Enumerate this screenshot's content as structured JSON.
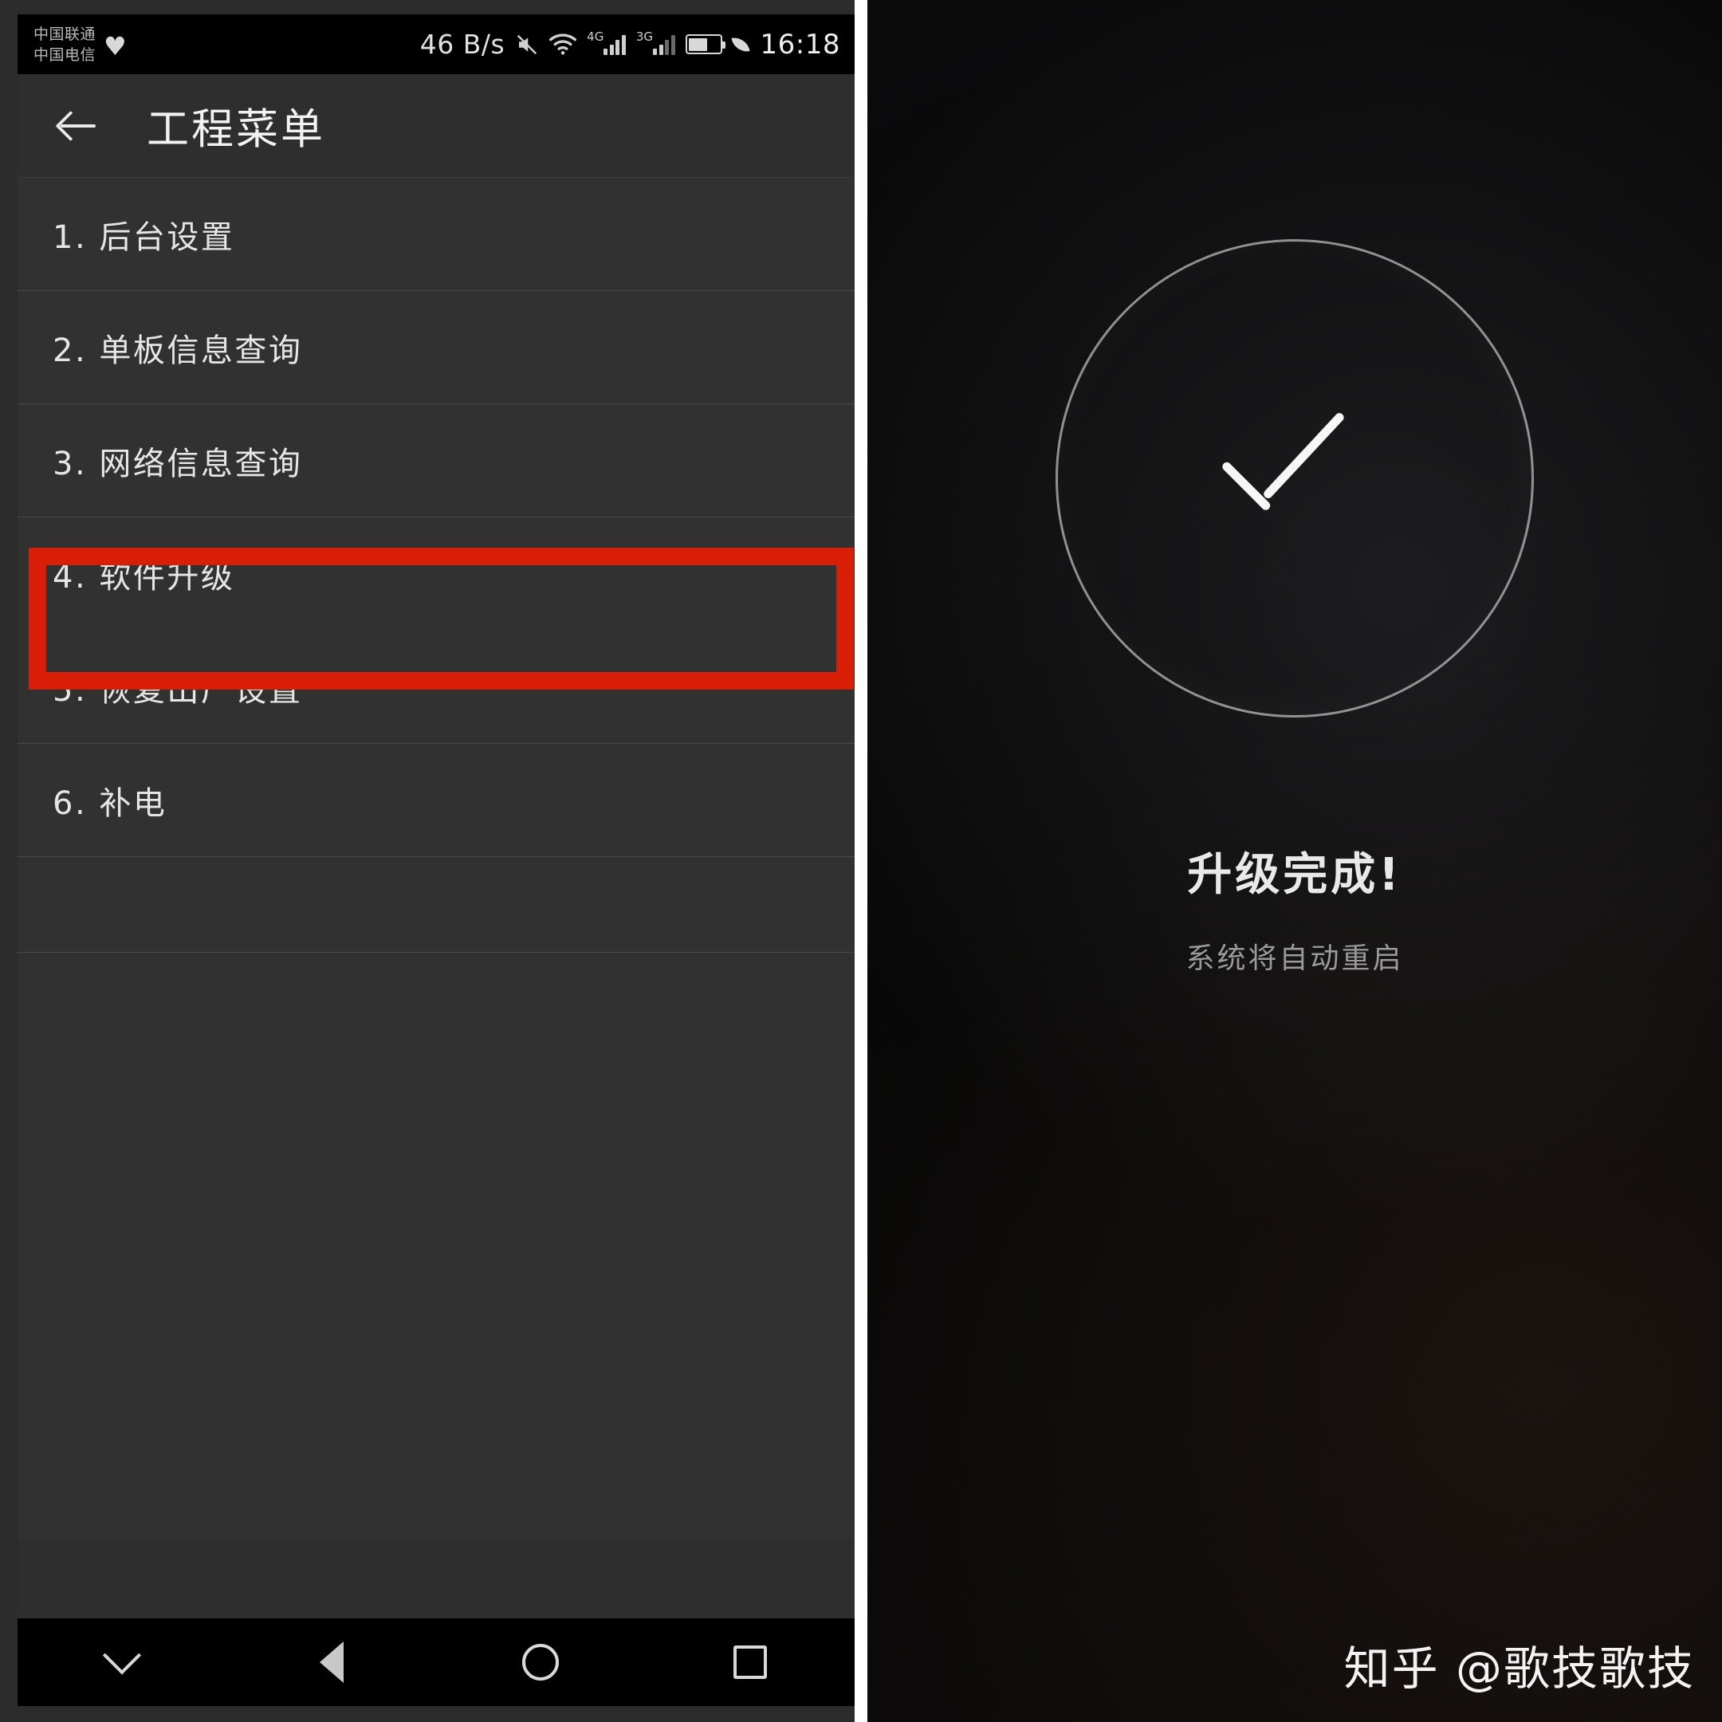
{
  "left_phone": {
    "status_bar": {
      "carrier_line1": "中国联通",
      "carrier_line2": "中国电信",
      "heart_icon": "heart-icon",
      "net_speed": "46 B/s",
      "mute_icon": "mute-icon",
      "wifi_icon": "wifi-icon",
      "signal1_label": "4G",
      "signal2_label": "3G",
      "battery_icon": "battery-icon",
      "leaf_icon": "power-saving-leaf-icon",
      "clock": "16:18"
    },
    "title_bar": {
      "back_icon": "back-arrow-icon",
      "title": "工程菜单"
    },
    "menu": {
      "items": [
        {
          "label": "1. 后台设置",
          "highlighted": false
        },
        {
          "label": "2. 单板信息查询",
          "highlighted": false
        },
        {
          "label": "3. 网络信息查询",
          "highlighted": false
        },
        {
          "label": "4. 软件升级",
          "highlighted": true
        },
        {
          "label": "5. 恢复出厂设置",
          "highlighted": false
        },
        {
          "label": "6. 补电",
          "highlighted": false
        }
      ],
      "highlight_color": "#d81e06"
    },
    "nav_bar": {
      "hide_icon": "chevron-down-icon",
      "back_icon": "triangle-back-icon",
      "home_icon": "circle-home-icon",
      "recents_icon": "square-recents-icon"
    }
  },
  "right_phone": {
    "status_icon": "check-circle-icon",
    "title": "升级完成!",
    "subtitle": "系统将自动重启",
    "watermark": "知乎 @歌技歌技"
  }
}
